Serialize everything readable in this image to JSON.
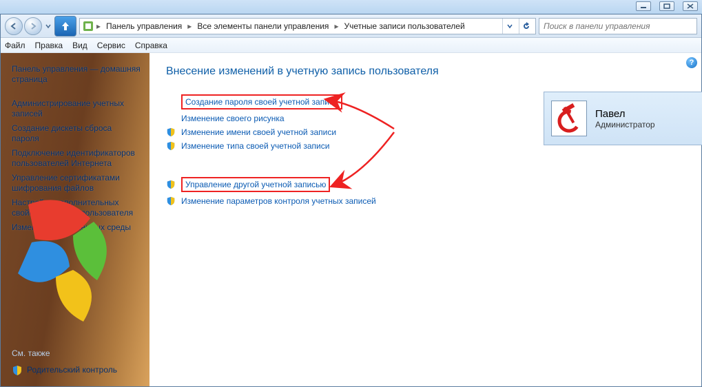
{
  "win_buttons": {
    "min": "minimize",
    "max": "maximize",
    "close": "close"
  },
  "nav": {
    "back": "back",
    "forward": "forward",
    "up": "up-one-level",
    "refresh": "refresh",
    "dropdown": "history-dropdown"
  },
  "breadcrumb": {
    "root_icon": "control-panel-icon",
    "items": [
      "Панель управления",
      "Все элементы панели управления",
      "Учетные записи пользователей"
    ]
  },
  "search": {
    "placeholder": "Поиск в панели управления"
  },
  "menu": [
    "Файл",
    "Правка",
    "Вид",
    "Сервис",
    "Справка"
  ],
  "sidebar": {
    "home": "Панель управления — домашняя страница",
    "links": [
      "Администрирование учетных записей",
      "Создание дискеты сброса пароля",
      "Подключение идентификаторов пользователей Интернета",
      "Управление сертификатами шифрования файлов",
      "Настройка дополнительных свойств профиля пользователя",
      "Изменение переменных среды"
    ],
    "see_also_hdr": "См. также",
    "see_also_link": "Родительский контроль"
  },
  "page": {
    "title": "Внесение изменений в учетную запись пользователя",
    "tasks_primary": [
      {
        "label": "Создание пароля своей учетной записи",
        "shield": false,
        "boxed": true
      },
      {
        "label": "Изменение своего рисунка",
        "shield": false,
        "boxed": false
      },
      {
        "label": "Изменение имени своей учетной записи",
        "shield": true,
        "boxed": false
      },
      {
        "label": "Изменение типа своей учетной записи",
        "shield": true,
        "boxed": false
      }
    ],
    "tasks_secondary": [
      {
        "label": "Управление другой учетной записью",
        "shield": true,
        "boxed": true
      },
      {
        "label": "Изменение параметров контроля учетных записей",
        "shield": true,
        "boxed": false
      }
    ]
  },
  "account": {
    "name": "Павел",
    "role": "Администратор"
  },
  "help": "?"
}
